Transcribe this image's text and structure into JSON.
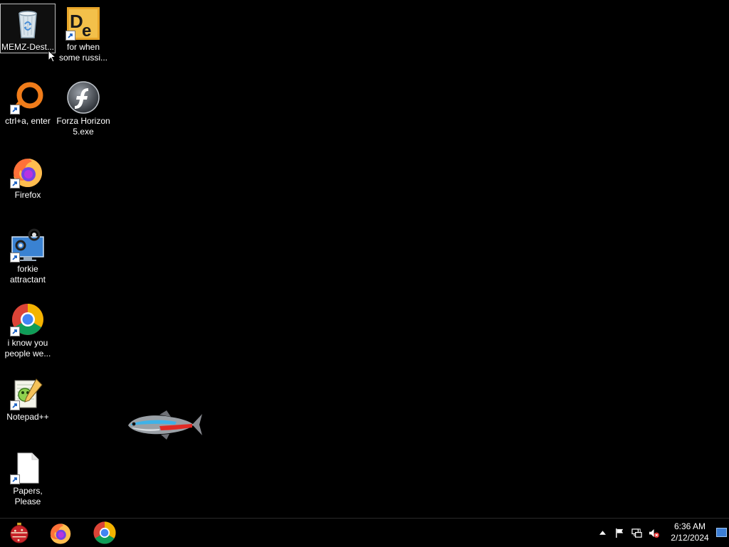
{
  "desktop": {
    "icons": [
      {
        "label": "MEMZ-Dest...",
        "icon": "recycle-bin-icon",
        "selected": true
      },
      {
        "label": "for when some russi...",
        "icon": "dependency-explorer-icon"
      },
      {
        "label": "ctrl+a, enter",
        "icon": "orange-ring-app-icon"
      },
      {
        "label": "Forza Horizon 5.exe",
        "icon": "flash-player-icon"
      },
      {
        "label": "Firefox",
        "icon": "firefox-icon"
      },
      {
        "label": "forkie attractant",
        "icon": "computer-settings-icon"
      },
      {
        "label": "i know you people we...",
        "icon": "chrome-icon"
      },
      {
        "label": "Notepad++",
        "icon": "notepad-plus-plus-icon"
      },
      {
        "label": "Papers, Please",
        "icon": "blank-file-icon"
      }
    ],
    "background_color": "#000000",
    "overlay": {
      "icon": "neon-tetra-fish-icon"
    }
  },
  "taskbar": {
    "pinned": [
      {
        "name": "start-orb",
        "icon": "christmas-ornament-icon"
      },
      {
        "name": "firefox",
        "icon": "firefox-icon"
      },
      {
        "name": "chrome",
        "icon": "chrome-icon"
      }
    ],
    "tray": {
      "icons": [
        "chevron-up-icon",
        "action-center-flag-icon",
        "network-icon",
        "volume-muted-icon"
      ],
      "time": "6:36 AM",
      "date": "2/12/2024"
    }
  }
}
